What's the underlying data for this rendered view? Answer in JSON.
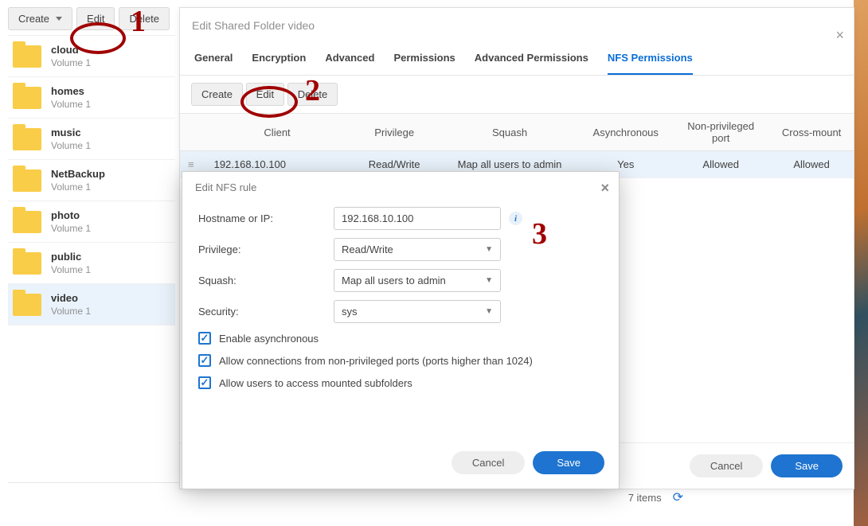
{
  "leftToolbar": {
    "create": "Create",
    "edit": "Edit",
    "delete": "Delete"
  },
  "folders": [
    {
      "name": "cloud",
      "vol": "Volume 1"
    },
    {
      "name": "homes",
      "vol": "Volume 1"
    },
    {
      "name": "music",
      "vol": "Volume 1"
    },
    {
      "name": "NetBackup",
      "vol": "Volume 1"
    },
    {
      "name": "photo",
      "vol": "Volume 1"
    },
    {
      "name": "public",
      "vol": "Volume 1"
    },
    {
      "name": "video",
      "vol": "Volume 1"
    }
  ],
  "selectedFolderIndex": 6,
  "footer": {
    "count": "7 items"
  },
  "modal1": {
    "title": "Edit Shared Folder video",
    "tabs": [
      "General",
      "Encryption",
      "Advanced",
      "Permissions",
      "Advanced Permissions",
      "NFS Permissions"
    ],
    "activeTab": 5,
    "toolbar": {
      "create": "Create",
      "edit": "Edit",
      "delete": "Delete"
    },
    "headers": [
      "Client",
      "Privilege",
      "Squash",
      "Asynchronous",
      "Non-privileged port",
      "Cross-mount"
    ],
    "rows": [
      {
        "client": "192.168.10.100",
        "privilege": "Read/Write",
        "squash": "Map all users to admin",
        "async": "Yes",
        "nonpriv": "Allowed",
        "cross": "Allowed"
      }
    ],
    "buttons": {
      "cancel": "Cancel",
      "save": "Save"
    }
  },
  "modal2": {
    "title": "Edit NFS rule",
    "fields": {
      "hostLabel": "Hostname or IP:",
      "hostValue": "192.168.10.100",
      "privLabel": "Privilege:",
      "privValue": "Read/Write",
      "squashLabel": "Squash:",
      "squashValue": "Map all users to admin",
      "secLabel": "Security:",
      "secValue": "sys"
    },
    "checks": {
      "async": "Enable asynchronous",
      "nonpriv": "Allow connections from non-privileged ports (ports higher than 1024)",
      "subfold": "Allow users to access mounted subfolders"
    },
    "buttons": {
      "cancel": "Cancel",
      "save": "Save"
    }
  },
  "annotations": {
    "n1": "1",
    "n2": "2",
    "n3": "3"
  }
}
